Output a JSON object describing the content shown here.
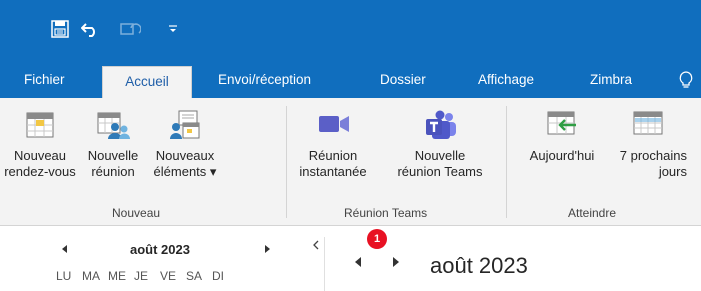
{
  "titlebar": {
    "icons": [
      "save-icon",
      "undo-icon",
      "send-receive-icon",
      "customize-qat-icon"
    ],
    "bg_color": "#106ebe"
  },
  "tabs": [
    {
      "label": "Fichier",
      "active": false
    },
    {
      "label": "Accueil",
      "active": true
    },
    {
      "label": "Envoi/réception",
      "active": false
    },
    {
      "label": "Dossier",
      "active": false
    },
    {
      "label": "Affichage",
      "active": false
    },
    {
      "label": "Zimbra",
      "active": false
    },
    {
      "label": "",
      "icon": "lightbulb-icon",
      "active": false
    }
  ],
  "ribbon": {
    "groups": [
      {
        "label": "Nouveau",
        "buttons": [
          {
            "label": "Nouveau\nrendez-vous",
            "icon": "new-appointment-icon"
          },
          {
            "label": "Nouvelle\nréunion",
            "icon": "new-meeting-icon"
          },
          {
            "label": "Nouveaux\néléments ▾",
            "icon": "new-items-icon"
          }
        ]
      },
      {
        "label": "Réunion Teams",
        "buttons": [
          {
            "label": "Réunion\ninstantanée",
            "icon": "video-camera-icon"
          },
          {
            "label": "Nouvelle\nréunion Teams",
            "icon": "teams-icon"
          }
        ]
      },
      {
        "label": "Atteindre",
        "buttons": [
          {
            "label": "Aujourd'hui",
            "icon": "go-to-today-icon"
          },
          {
            "label": "7 prochains\njours",
            "icon": "next-7-days-icon"
          }
        ]
      }
    ]
  },
  "minical": {
    "title": "août 2023",
    "weekdays": [
      "LU",
      "MA",
      "ME",
      "JE",
      "VE",
      "SA",
      "DI"
    ]
  },
  "calendar_view": {
    "title": "août 2023",
    "notification_count": "1"
  }
}
